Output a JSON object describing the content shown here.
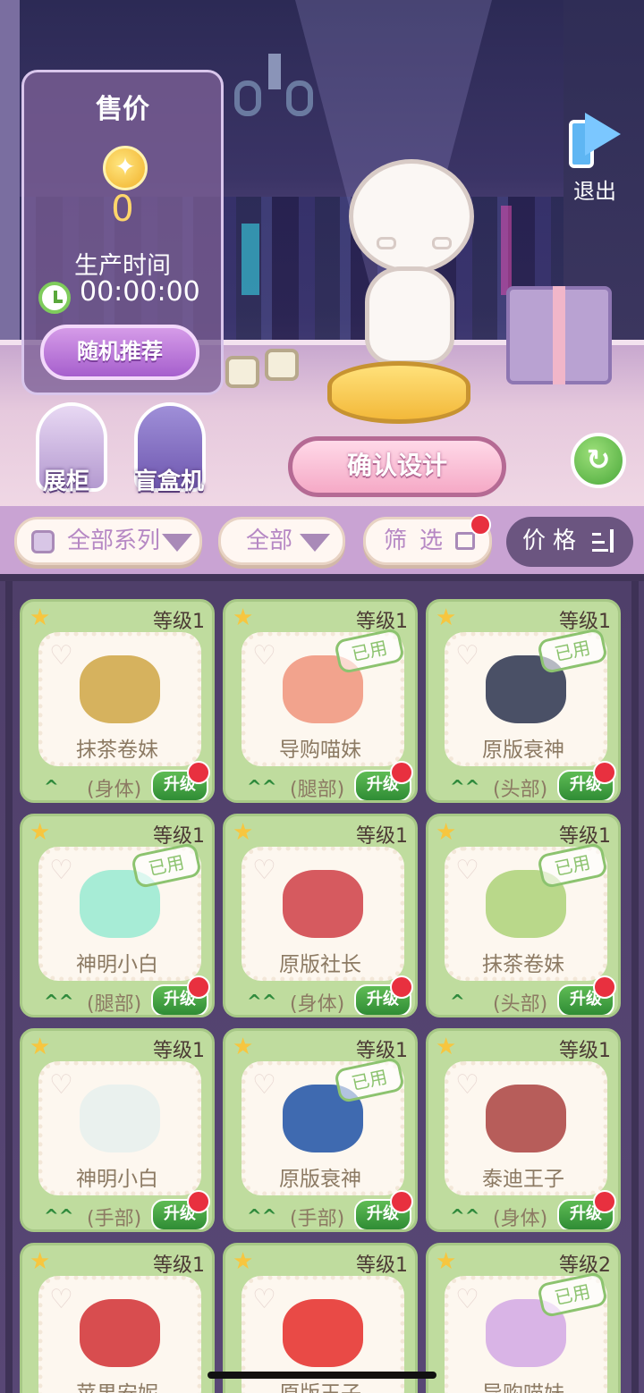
{
  "price_panel": {
    "title": "售价",
    "price": "0",
    "production_label": "生产时间",
    "production_time": "00:00:00",
    "random_button": "随机推荐"
  },
  "quit": {
    "label": "退出"
  },
  "side_buttons": {
    "cabinet": "展柜",
    "blindbox": "盲盒机"
  },
  "confirm_button": "确认设计",
  "filters": {
    "series": "全部系列",
    "category": "全部",
    "filter": "筛选",
    "price_sort": "价格"
  },
  "colors": {
    "card_bg": "#bfdc9e",
    "accent_green": "#2f8c35",
    "badge_red": "#e8303f"
  },
  "items": [
    {
      "level": "等级1",
      "name": "抹茶卷妹",
      "part": "(身体)",
      "used": "",
      "upgrade": "升级",
      "arrow": "^",
      "art": "#d6b25e"
    },
    {
      "level": "等级1",
      "name": "导购喵妹",
      "part": "(腿部)",
      "used": "已用",
      "upgrade": "升级",
      "arrow": "^^",
      "art": "#f2a38d"
    },
    {
      "level": "等级1",
      "name": "原版衰神",
      "part": "(头部)",
      "used": "已用",
      "upgrade": "升级",
      "arrow": "^^",
      "art": "#4a5066"
    },
    {
      "level": "等级1",
      "name": "神明小白",
      "part": "(腿部)",
      "used": "已用",
      "upgrade": "升级",
      "arrow": "^^",
      "art": "#a7ecd6"
    },
    {
      "level": "等级1",
      "name": "原版社长",
      "part": "(身体)",
      "used": "",
      "upgrade": "升级",
      "arrow": "^^",
      "art": "#d65a5f"
    },
    {
      "level": "等级1",
      "name": "抹茶卷妹",
      "part": "(头部)",
      "used": "已用",
      "upgrade": "升级",
      "arrow": "^",
      "art": "#b9d88a"
    },
    {
      "level": "等级1",
      "name": "神明小白",
      "part": "(手部)",
      "used": "",
      "upgrade": "升级",
      "arrow": "^^",
      "art": "#eaf1ee"
    },
    {
      "level": "等级1",
      "name": "原版衰神",
      "part": "(手部)",
      "used": "已用",
      "upgrade": "升级",
      "arrow": "^^",
      "art": "#3f6ab0"
    },
    {
      "level": "等级1",
      "name": "泰迪王子",
      "part": "(身体)",
      "used": "",
      "upgrade": "升级",
      "arrow": "^^",
      "art": "#b75d5a"
    },
    {
      "level": "等级1",
      "name": "苹果安妮",
      "part": "",
      "used": "",
      "upgrade": "",
      "arrow": "",
      "art": "#d84d4f"
    },
    {
      "level": "等级1",
      "name": "原版王子",
      "part": "",
      "used": "",
      "upgrade": "",
      "arrow": "",
      "art": "#e94a46"
    },
    {
      "level": "等级2",
      "name": "导购喵妹",
      "part": "",
      "used": "已用",
      "upgrade": "",
      "arrow": "",
      "art": "#d9b4e6"
    }
  ]
}
